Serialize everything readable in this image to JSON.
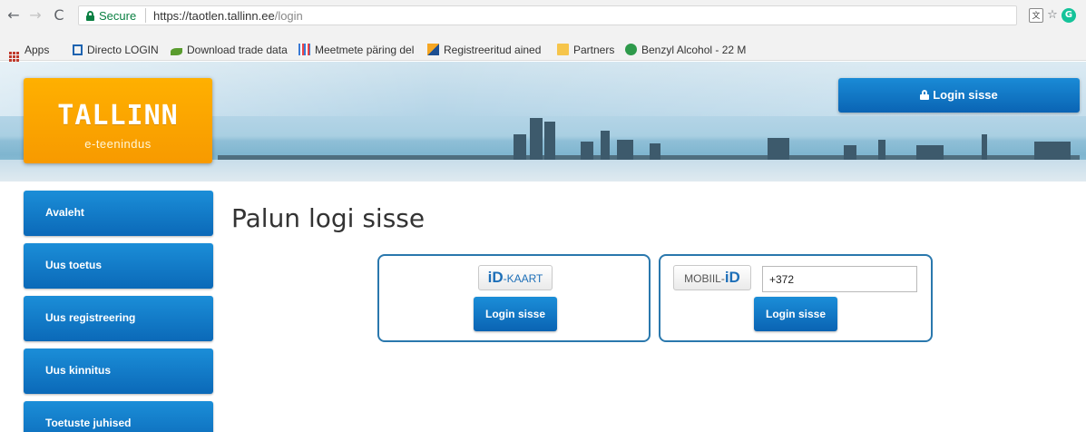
{
  "browser": {
    "nav": {
      "back_icon": "←",
      "forward_icon": "→",
      "reload_icon": "C"
    },
    "secure_label": "Secure",
    "url_host": "https://taotlen.tallinn.ee",
    "url_path": "/login",
    "star_icon": "☆",
    "bookmarks": [
      {
        "label": "Apps"
      },
      {
        "label": "Directo LOGIN"
      },
      {
        "label": "Download trade data"
      },
      {
        "label": "Meetmete päring del"
      },
      {
        "label": "Registreeritud ained"
      },
      {
        "label": "Partners"
      },
      {
        "label": "Benzyl Alcohol - 22 M"
      }
    ]
  },
  "header": {
    "logo_text": "TALLINN",
    "logo_subtitle": "e-teenindus",
    "login_button": "Login sisse"
  },
  "sidebar": {
    "items": [
      {
        "label": "Avaleht"
      },
      {
        "label": "Uus toetus"
      },
      {
        "label": "Uus registreering"
      },
      {
        "label": "Uus kinnitus"
      },
      {
        "label": "Toetuste juhised"
      }
    ]
  },
  "main": {
    "title": "Palun logi sisse",
    "id_card": {
      "badge_prefix": "iD",
      "badge_text": "-KAART",
      "button": "Login sisse"
    },
    "mobile_id": {
      "badge_prefix": "MOBIIL-",
      "badge_suffix": "iD",
      "phone_value": "+372",
      "button": "Login sisse"
    }
  },
  "colors": {
    "accent_blue": "#0b69b8",
    "logo_orange": "#f79a00",
    "secure_green": "#0b8043",
    "card_border": "#2a78ad"
  }
}
